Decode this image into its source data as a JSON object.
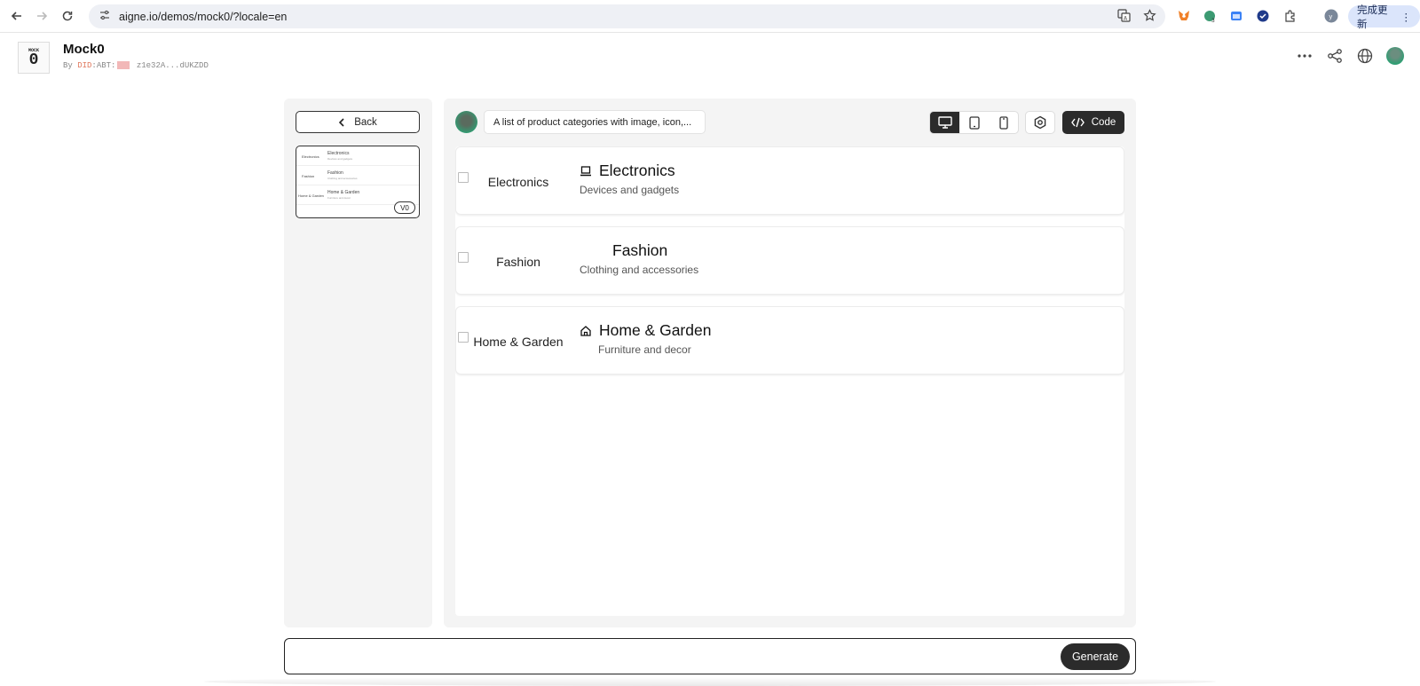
{
  "browser": {
    "url": "aigne.io/demos/mock0/?locale=en",
    "update_label": "完成更新"
  },
  "app": {
    "logo_top": "MOCK",
    "logo_main": "0",
    "title": "Mock0",
    "by_prefix": "By",
    "did_label": "DID",
    "abt_label": ":ABT:",
    "address": "z1e32A...dUKZDD"
  },
  "sidebar": {
    "back_label": "Back",
    "version_badge": "V0",
    "thumb_rows": [
      {
        "left": "Electronics",
        "title": "Electronics",
        "sub": "Devices and gadgets"
      },
      {
        "left": "Fashion",
        "title": "Fashion",
        "sub": "Clothing and accessories"
      },
      {
        "left": "Home & Garden",
        "title": "Home & Garden",
        "sub": "Furniture and decor"
      }
    ]
  },
  "toolbar": {
    "prompt": "A list of product categories with image, icon,...",
    "code_label": "Code"
  },
  "categories": [
    {
      "image_alt": "Electronics",
      "icon": "laptop-icon",
      "title": "Electronics",
      "description": "Devices and gadgets"
    },
    {
      "image_alt": "Fashion",
      "icon": "",
      "title": "Fashion",
      "description": "Clothing and accessories"
    },
    {
      "image_alt": "Home & Garden",
      "icon": "home-icon",
      "title": "Home & Garden",
      "description": "Furniture and decor"
    }
  ],
  "input": {
    "placeholder": "",
    "generate_label": "Generate"
  },
  "colors": {
    "accent_dark": "#2b2b2b",
    "did_color": "#e07a5f",
    "update_bg": "#dbe5fb"
  }
}
